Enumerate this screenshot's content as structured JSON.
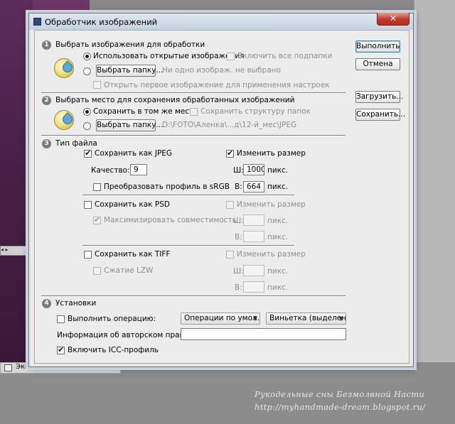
{
  "window": {
    "title": "Обработчик изображений",
    "close_label": "✕"
  },
  "buttons": {
    "run": "Выполнить",
    "cancel": "Отмена",
    "load": "Загрузить...",
    "save": "Сохранить..."
  },
  "section1": {
    "number": "1",
    "title": "Выбрать изображения для обработки",
    "use_open": "Использовать открытые изображения",
    "include_subfolders": "Включить все подпапки",
    "choose_folder": "Выбрать папку...",
    "none_selected": "Ни одно изображ. не выбрано",
    "open_first": "Открыть первое изображение для применения настроек"
  },
  "section2": {
    "number": "2",
    "title": "Выбрать место для сохранения обработанных изображений",
    "save_same": "Сохранить в том же месте",
    "keep_structure": "Сохранить структуру папок",
    "choose_folder": "Выбрать папку...",
    "path": "D:\\FOTO\\Аленка\\...д\\12-й_мес\\JPEG"
  },
  "section3": {
    "number": "3",
    "title": "Тип файла",
    "jpeg": {
      "save_as": "Сохранить как JPEG",
      "resize": "Изменить размер",
      "quality_label": "Качество:",
      "quality_value": "9",
      "w_label": "Ш:",
      "w_value": "1000",
      "h_label": "В:",
      "h_value": "664",
      "unit": "пикс.",
      "convert_srgb": "Преобразовать профиль в sRGB"
    },
    "psd": {
      "save_as": "Сохранить как PSD",
      "resize": "Изменить размер",
      "maximize": "Максимизировать совместимость",
      "w_label": "Ш:",
      "h_label": "В:",
      "unit": "пикс."
    },
    "tiff": {
      "save_as": "Сохранить как TIFF",
      "resize": "Изменить размер",
      "lzw": "Сжатие LZW",
      "w_label": "Ш:",
      "h_label": "В:",
      "unit": "пикс."
    }
  },
  "section4": {
    "number": "4",
    "title": "Установки",
    "run_action": "Выполнить операцию:",
    "action_set": "Операции по умол...",
    "action": "Виньетка (выделен...",
    "copyright_label": "Информация об авторском праве:",
    "copyright_value": "",
    "icc": "Включить ICC-профиль"
  },
  "background": {
    "status_text": "Экспозиция работает только в ...",
    "side_control": "◂ ▸"
  },
  "watermark": {
    "line1": "Рукодельные сны Безмолвной Насти",
    "line2": "http://myhandmade-dream.blogspot.ru/"
  }
}
